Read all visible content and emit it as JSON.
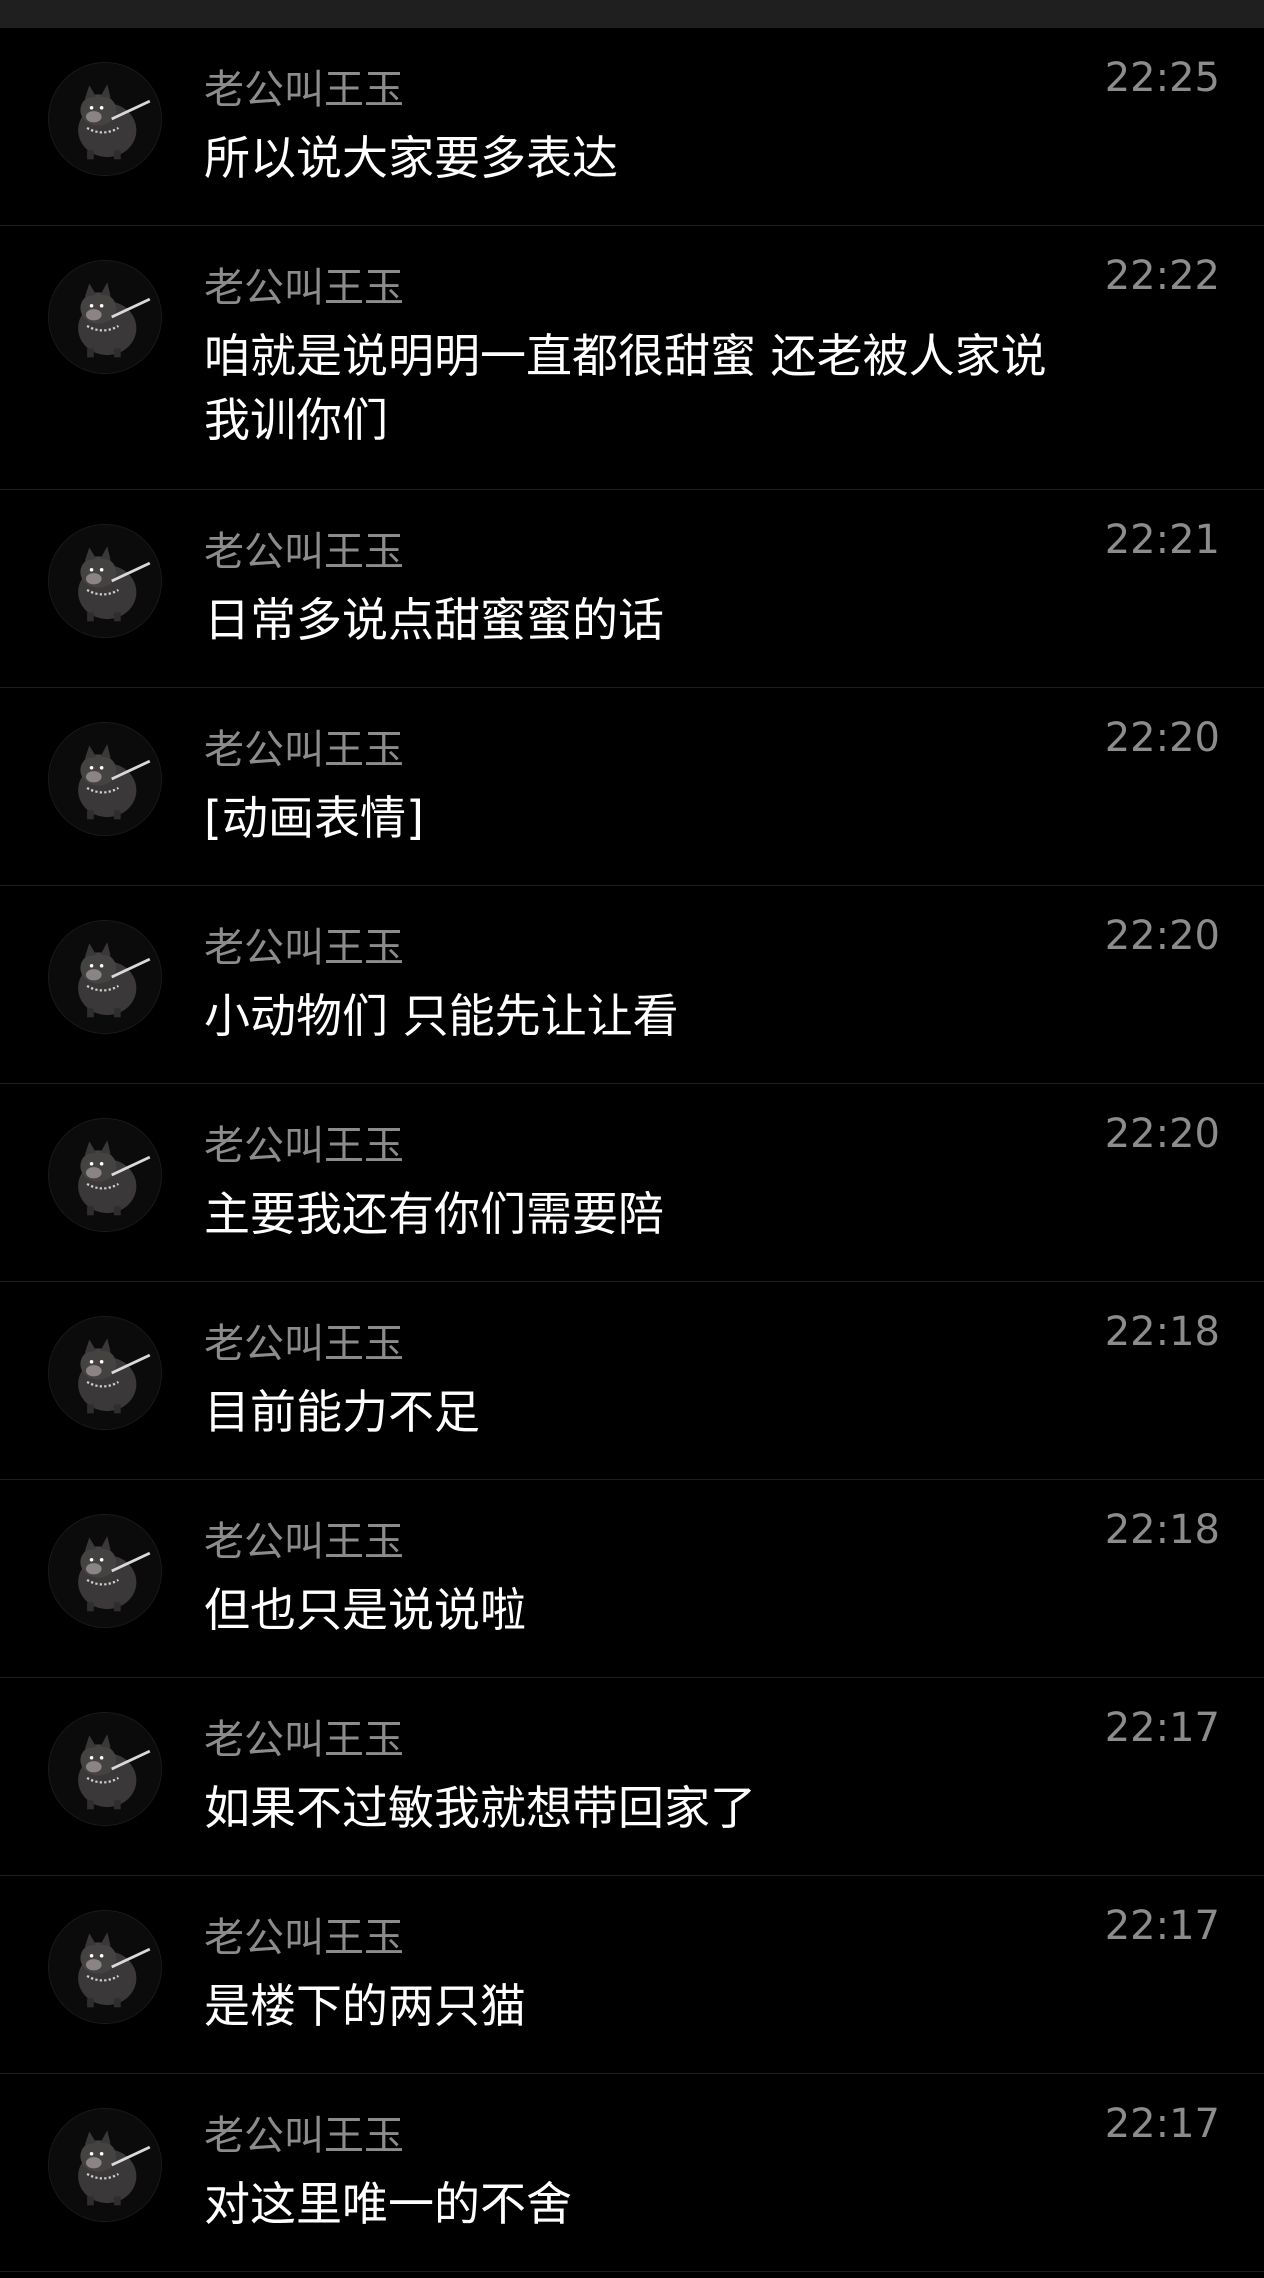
{
  "messages": [
    {
      "sender": "老公叫王玉",
      "time": "22:25",
      "text": "所以说大家要多表达"
    },
    {
      "sender": "老公叫王玉",
      "time": "22:22",
      "text": "咱就是说明明一直都很甜蜜 还老被人家说我训你们"
    },
    {
      "sender": "老公叫王玉",
      "time": "22:21",
      "text": "日常多说点甜蜜蜜的话"
    },
    {
      "sender": "老公叫王玉",
      "time": "22:20",
      "text": "[动画表情]"
    },
    {
      "sender": "老公叫王玉",
      "time": "22:20",
      "text": "小动物们 只能先让让看"
    },
    {
      "sender": "老公叫王玉",
      "time": "22:20",
      "text": "主要我还有你们需要陪"
    },
    {
      "sender": "老公叫王玉",
      "time": "22:18",
      "text": "目前能力不足"
    },
    {
      "sender": "老公叫王玉",
      "time": "22:18",
      "text": "但也只是说说啦"
    },
    {
      "sender": "老公叫王玉",
      "time": "22:17",
      "text": "如果不过敏我就想带回家了"
    },
    {
      "sender": "老公叫王玉",
      "time": "22:17",
      "text": "是楼下的两只猫"
    },
    {
      "sender": "老公叫王玉",
      "time": "22:17",
      "text": "对这里唯一的不舍"
    }
  ],
  "colors": {
    "background": "#000000",
    "sender": "#8c8c8c",
    "time": "#8c8c8c",
    "message": "#ffffff",
    "divider": "#1e1e1e"
  },
  "icons": {
    "avatar": "dog-avatar-icon"
  }
}
